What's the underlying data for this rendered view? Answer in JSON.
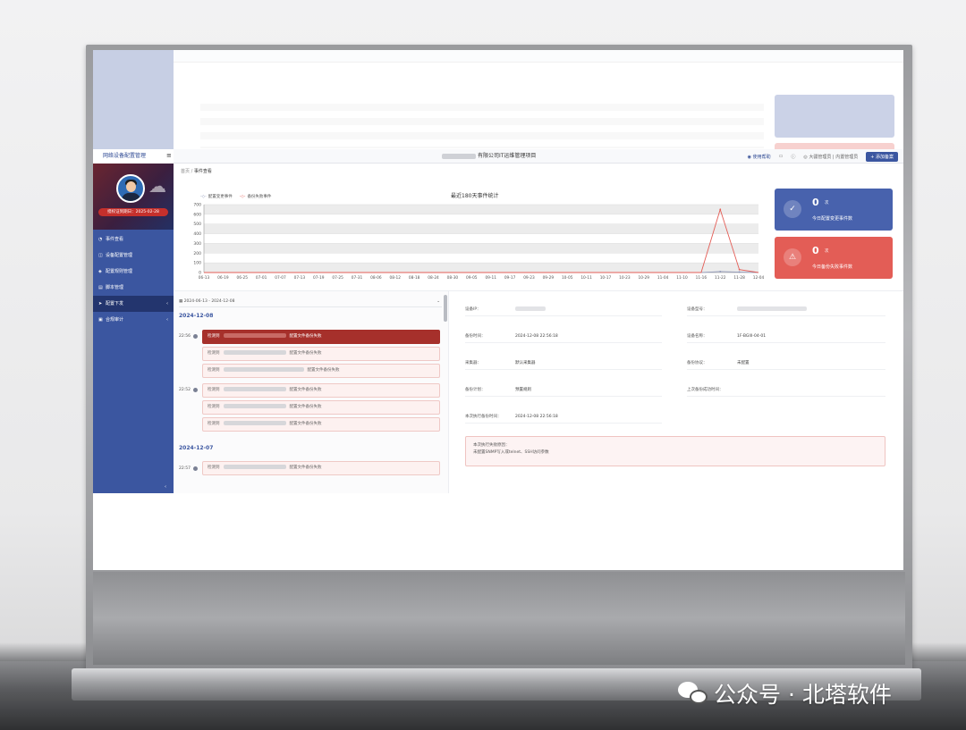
{
  "app": {
    "brand": "网络设备配置管理",
    "company_suffix": "有限公司IT运维管理项目",
    "topbar_right": {
      "help": "使用帮助",
      "user": "大疆管理员",
      "role": "内置管理员",
      "submit": "+ 添加备案"
    },
    "license": "授权证到期日：2025-02-28"
  },
  "sidebar": {
    "items": [
      {
        "label": "事件查看",
        "icon": "bell-icon",
        "active": false
      },
      {
        "label": "设备配置管理",
        "icon": "device-icon",
        "active": false
      },
      {
        "label": "配置规则管理",
        "icon": "rule-icon",
        "active": false
      },
      {
        "label": "脚本管理",
        "icon": "script-icon",
        "active": false
      },
      {
        "label": "配置下发",
        "icon": "send-icon",
        "active": true
      },
      {
        "label": "合规审计",
        "icon": "audit-icon",
        "active": false
      }
    ]
  },
  "breadcrumb": {
    "home": "首页",
    "sep": "/",
    "current": "事件查看"
  },
  "chart_data": {
    "type": "line",
    "title": "最近180天事件统计",
    "legend": [
      "配置变更事件",
      "备份失败事件"
    ],
    "legend_placement": "top-left",
    "ylim": [
      0,
      700
    ],
    "yticks": [
      0,
      100,
      200,
      300,
      400,
      500,
      600,
      700
    ],
    "grid": true,
    "categories": [
      "06-13",
      "06-19",
      "06-25",
      "07-01",
      "07-07",
      "07-13",
      "07-19",
      "07-25",
      "07-31",
      "08-06",
      "08-12",
      "08-18",
      "08-24",
      "08-30",
      "09-05",
      "09-11",
      "09-17",
      "09-23",
      "09-29",
      "10-05",
      "10-11",
      "10-17",
      "10-23",
      "10-29",
      "11-04",
      "11-10",
      "11-16",
      "11-22",
      "11-28",
      "12-04"
    ],
    "series": [
      {
        "name": "配置变更事件",
        "color": "#8a93b8",
        "values": [
          0,
          0,
          0,
          0,
          0,
          0,
          0,
          0,
          0,
          0,
          0,
          0,
          0,
          0,
          0,
          0,
          0,
          0,
          0,
          0,
          0,
          0,
          0,
          0,
          0,
          0,
          0,
          10,
          5,
          0
        ]
      },
      {
        "name": "备份失败事件",
        "color": "#e35d56",
        "values": [
          0,
          0,
          0,
          0,
          0,
          0,
          0,
          0,
          0,
          0,
          0,
          0,
          0,
          0,
          0,
          0,
          0,
          0,
          0,
          0,
          0,
          0,
          0,
          0,
          0,
          0,
          0,
          650,
          30,
          0
        ]
      }
    ]
  },
  "stats": [
    {
      "value": "0",
      "unit": "次",
      "label": "今日配置变更事件数",
      "icon": "calendar-check-icon",
      "color": "#4862ad"
    },
    {
      "value": "0",
      "unit": "次",
      "label": "今日备份失败事件数",
      "icon": "warning-icon",
      "color": "#e35d56"
    }
  ],
  "timeline": {
    "date_range": "2024-06-13 - 2024-12-08",
    "groups": [
      {
        "date": "2024-12-08",
        "times": [
          {
            "time": "22:56",
            "entries": [
              {
                "prefix": "检测到",
                "suffix": "配置文件备份失败",
                "selected": true
              },
              {
                "prefix": "检测到",
                "suffix": "配置文件备份失败",
                "selected": false
              },
              {
                "prefix": "检测到",
                "suffix": "配置文件备份失败",
                "selected": false
              }
            ]
          },
          {
            "time": "22:52",
            "entries": [
              {
                "prefix": "检测到",
                "suffix": "配置文件备份失败",
                "selected": false
              },
              {
                "prefix": "检测到",
                "suffix": "配置文件备份失败",
                "selected": false
              },
              {
                "prefix": "检测到",
                "suffix": "配置文件备份失败",
                "selected": false
              }
            ]
          }
        ]
      },
      {
        "date": "2024-12-07",
        "times": [
          {
            "time": "22:57",
            "entries": [
              {
                "prefix": "检测到",
                "suffix": "配置文件备份失败",
                "selected": false
              }
            ]
          }
        ]
      }
    ]
  },
  "detail": {
    "device_ip_label": "设备IP：",
    "device_model_label": "设备型号：",
    "backup_time_label": "备份时间：",
    "backup_time": "2024-12-08 22:56:18",
    "device_name_label": "设备名称：",
    "device_name": "1F-BGIII-04-01",
    "collector_label": "采集器：",
    "collector": "默认采集器",
    "protocol_label": "备份协议：",
    "protocol": "未配置",
    "plan_label": "备份计划：",
    "plan": "预置规则",
    "last_success_label": "上次备份成功时间：",
    "last_exec_label": "本次执行备份时间：",
    "last_exec": "2024-12-08 22:56:18",
    "fail_title": "本次执行失败原因：",
    "fail_reason": "未配置SNMP写入或telnet、SSH访问参数"
  },
  "watermark": "公众号 · 北塔软件"
}
